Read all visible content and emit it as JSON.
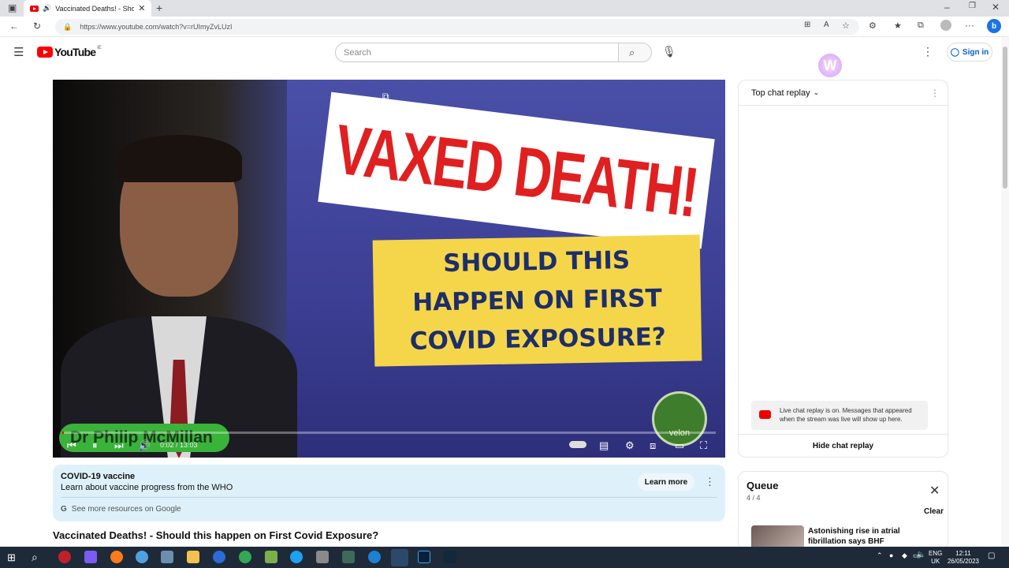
{
  "browser": {
    "tab_title": "Vaccinated Deaths! - Shoul",
    "url": "https://www.youtube.com/watch?v=rUImyZvLUzI"
  },
  "youtube": {
    "logo_text": "YouTube",
    "logo_region": "IE",
    "search_placeholder": "Search",
    "signin_label": "Sign in"
  },
  "video": {
    "banner_line1": "VAXED DEATH!",
    "banner_line2": "SHOULD THIS",
    "banner_line3": "HAPPEN ON FIRST",
    "banner_line4": "COVID EXPOSURE?",
    "name_tag": "Dr Philip McMillan",
    "logo_text": "velon",
    "time_display": "0:02 / 13:03",
    "progress": 0.003
  },
  "info_panel": {
    "title": "COVID-19 vaccine",
    "subtitle": "Learn about vaccine progress from the WHO",
    "learn_more": "Learn more",
    "google_link": "See more resources on Google"
  },
  "video_title": "Vaccinated Deaths! - Should this happen on First Covid Exposure?",
  "chat": {
    "header": "Top chat replay",
    "note": "Live chat replay is on. Messages that appeared when the stream was live will show up here.",
    "hide_label": "Hide chat replay"
  },
  "queue": {
    "title": "Queue",
    "count": "4 / 4",
    "clear": "Clear",
    "item_title": "Astonishing rise in atrial fibrillation says BHF"
  },
  "taskbar": {
    "lang_line1": "ENG",
    "lang_line2": "UK",
    "time": "12:11",
    "date": "26/05/2023"
  },
  "colors": {
    "youtube_red": "#ff0000",
    "link_blue": "#065fd4",
    "info_bg": "#def1fa",
    "banner_red": "#e02020",
    "banner_yellow": "#f5d64a"
  }
}
